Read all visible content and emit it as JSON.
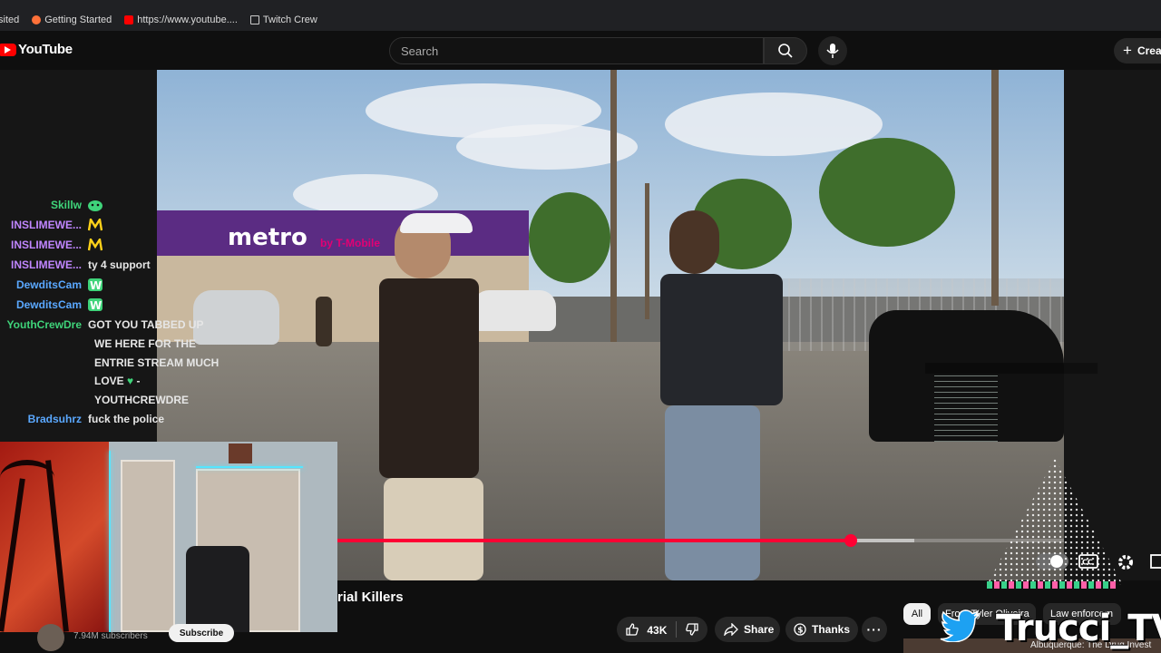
{
  "colors": {
    "yt_red": "#ff0000",
    "progress_red": "#ff0033",
    "background": "#0f0f0f",
    "chat_green": "#3fd47a",
    "chat_purple": "#c086ff",
    "chat_blue": "#5aa8ff"
  },
  "bookmarks": [
    {
      "label": "sited"
    },
    {
      "label": "Getting Started",
      "icon": "firefox-icon"
    },
    {
      "label": "https://www.youtube....",
      "icon": "youtube-favicon"
    },
    {
      "label": "Twitch Crew",
      "icon": "folder-icon"
    }
  ],
  "header": {
    "logo_text": "YouTube",
    "search_placeholder": "Search",
    "create_label": "Crea"
  },
  "video": {
    "sign_text": "metro",
    "sign_sub": "by T-Mobile",
    "progress_fraction": 0.765,
    "buffered_fraction": 0.835
  },
  "chat": {
    "messages": [
      {
        "user": "Skillw",
        "color": "#3fd47a",
        "text": "",
        "badge": "green-emote"
      },
      {
        "user": "INSLIMEWE...",
        "color": "#c086ff",
        "text": "",
        "badge": "yellow-emote"
      },
      {
        "user": "INSLIMEWE...",
        "color": "#c086ff",
        "text": "",
        "badge": "yellow-emote"
      },
      {
        "user": "INSLIMEWE...",
        "color": "#c086ff",
        "text": "ty 4 support"
      },
      {
        "user": "DewditsCam",
        "color": "#5aa8ff",
        "text": "",
        "badge": "w-emote"
      },
      {
        "user": "DewditsCam",
        "color": "#5aa8ff",
        "text": "",
        "badge": "w-emote"
      },
      {
        "user": "YouthCrewDre",
        "color": "#3fd47a",
        "text": "GOT YOU TABBED UP"
      }
    ],
    "continuation": [
      "WE HERE FOR THE",
      "ENTRIE STREAM MUCH",
      "LOVE",
      "- ",
      "YOUTHCREWDRE"
    ],
    "last": {
      "user": "Bradsuhrz",
      "color": "#5aa8ff",
      "text": "fuck the police"
    }
  },
  "below": {
    "title": "rial Killers",
    "subscribers": "7.94M subscribers",
    "subscribe_label": "Subscribe",
    "like_count": "43K",
    "share_label": "Share",
    "thanks_label": "Thanks",
    "chips": [
      "All",
      "From Tyler Oliveira",
      "Law enforcem"
    ]
  },
  "overlay": {
    "brand": "Trucci_TV",
    "thumb_text": "Albuquerque: The Drug Invest"
  }
}
